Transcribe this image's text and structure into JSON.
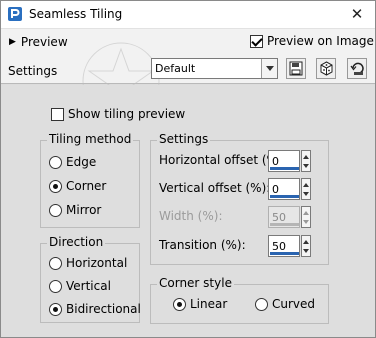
{
  "window": {
    "title": "Seamless Tiling",
    "close_glyph": "✕"
  },
  "topbar": {
    "preview_label": "Preview",
    "preview_on_image_label": "Preview on Image",
    "preview_on_image_checked": true,
    "settings_label": "Settings",
    "preset_value": "Default"
  },
  "main": {
    "show_tiling_label": "Show tiling preview",
    "show_tiling_checked": false,
    "tiling_method": {
      "title": "Tiling method",
      "options": [
        "Edge",
        "Corner",
        "Mirror"
      ],
      "selected": "Corner"
    },
    "direction": {
      "title": "Direction",
      "options": [
        "Horizontal",
        "Vertical",
        "Bidirectional"
      ],
      "selected": "Bidirectional"
    },
    "settings": {
      "title": "Settings",
      "fields": [
        {
          "label": "Horizontal offset (%):",
          "value": "0",
          "enabled": true
        },
        {
          "label": "Vertical offset (%):",
          "value": "0",
          "enabled": true
        },
        {
          "label": "Width (%):",
          "value": "50",
          "enabled": false
        },
        {
          "label": "Transition (%):",
          "value": "50",
          "enabled": true
        }
      ]
    },
    "corner_style": {
      "title": "Corner style",
      "options": [
        "Linear",
        "Curved"
      ],
      "selected": "Linear"
    }
  },
  "icons": [
    "app-logo-icon",
    "save-preset-icon",
    "randomize-icon",
    "reset-icon"
  ]
}
